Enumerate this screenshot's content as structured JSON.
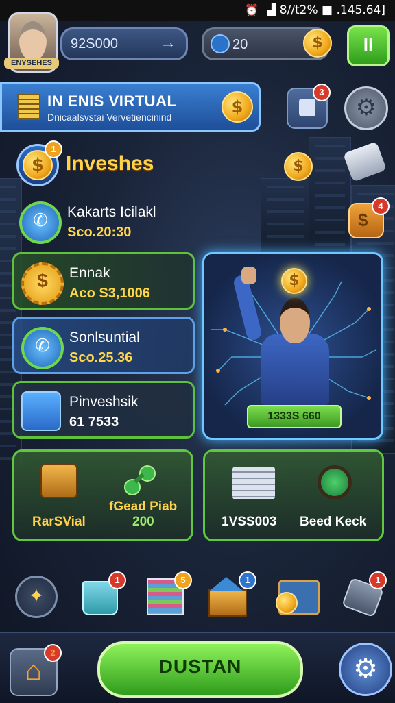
{
  "status_bar": {
    "icons": "⏰ ▟",
    "text": "8//t2% ■ .145.64]"
  },
  "profile": {
    "label": "ENYSEHES"
  },
  "currency": {
    "coins": "92S000",
    "gems": "20"
  },
  "banner": {
    "title": "IN ENIS VIRTUAL",
    "subtitle": "Dnicaalsvstai Vervetiencinind"
  },
  "section": {
    "title": "Inveshes",
    "badge": "1"
  },
  "side_badges": {
    "profile_card": "3",
    "shop": "4"
  },
  "rows": [
    {
      "title": "Kakarts Icilakl",
      "value": "Sco.20:30"
    },
    {
      "title": "Ennak",
      "value": "Aco S3,1006"
    },
    {
      "title": "Sonlsuntial",
      "value": "Sco.25.36"
    },
    {
      "title": "Pinveshsik",
      "value": "61 7533"
    }
  ],
  "hero": {
    "button": "1333S 660"
  },
  "cards": [
    {
      "left_label": "RarSVial",
      "right_label": "fGead Piab",
      "right_value": "200"
    },
    {
      "left_label": "1VSS003",
      "right_label": "Beed Keck"
    }
  ],
  "toolbar_badges": [
    "1",
    "5",
    "1",
    "1"
  ],
  "nav": {
    "home_badge": "2",
    "primary_button": "DUSTAN"
  },
  "colors": {
    "accent_green": "#5fc23a",
    "accent_gold": "#ffd24a",
    "accent_blue": "#6fc8ff"
  }
}
